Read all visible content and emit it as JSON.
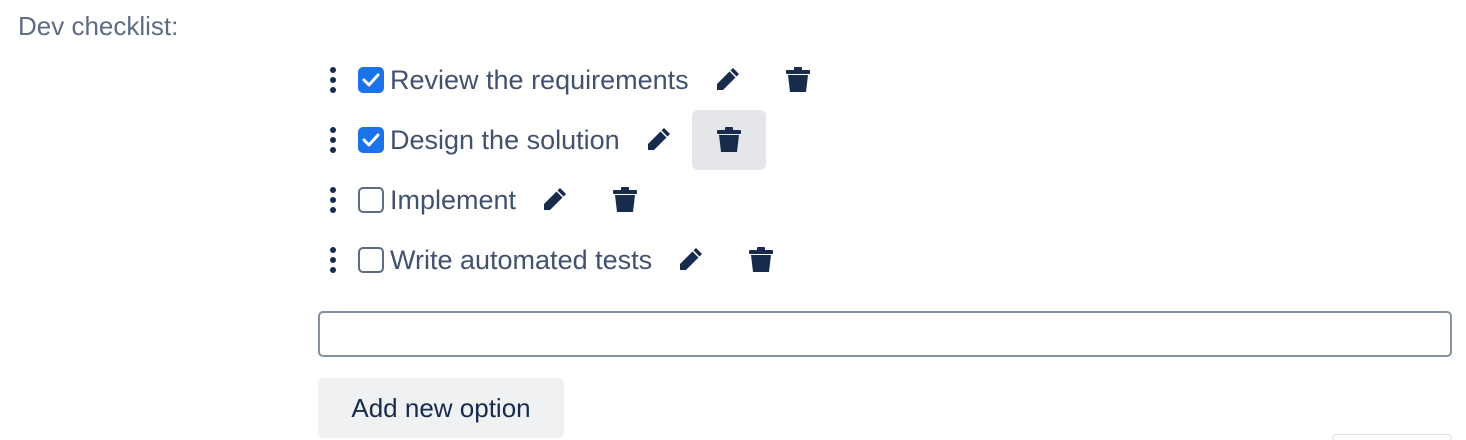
{
  "field": {
    "label": "Dev checklist:"
  },
  "items": [
    {
      "label": "Review the requirements",
      "checked": true
    },
    {
      "label": "Design the solution",
      "checked": true
    },
    {
      "label": "Implement",
      "checked": false
    },
    {
      "label": "Write automated tests",
      "checked": false
    }
  ],
  "new_option": {
    "value": "",
    "placeholder": ""
  },
  "add_button": {
    "label": "Add new option"
  },
  "icons": {
    "drag": "vertical-dots-icon",
    "check": "checkmark-icon",
    "edit": "pencil-icon",
    "delete": "trash-icon"
  },
  "colors": {
    "checkbox_checked": "#1a73e8",
    "icon_dark": "#172b4d",
    "label_text": "#42526e",
    "hover_bg": "#e4e6ea"
  }
}
